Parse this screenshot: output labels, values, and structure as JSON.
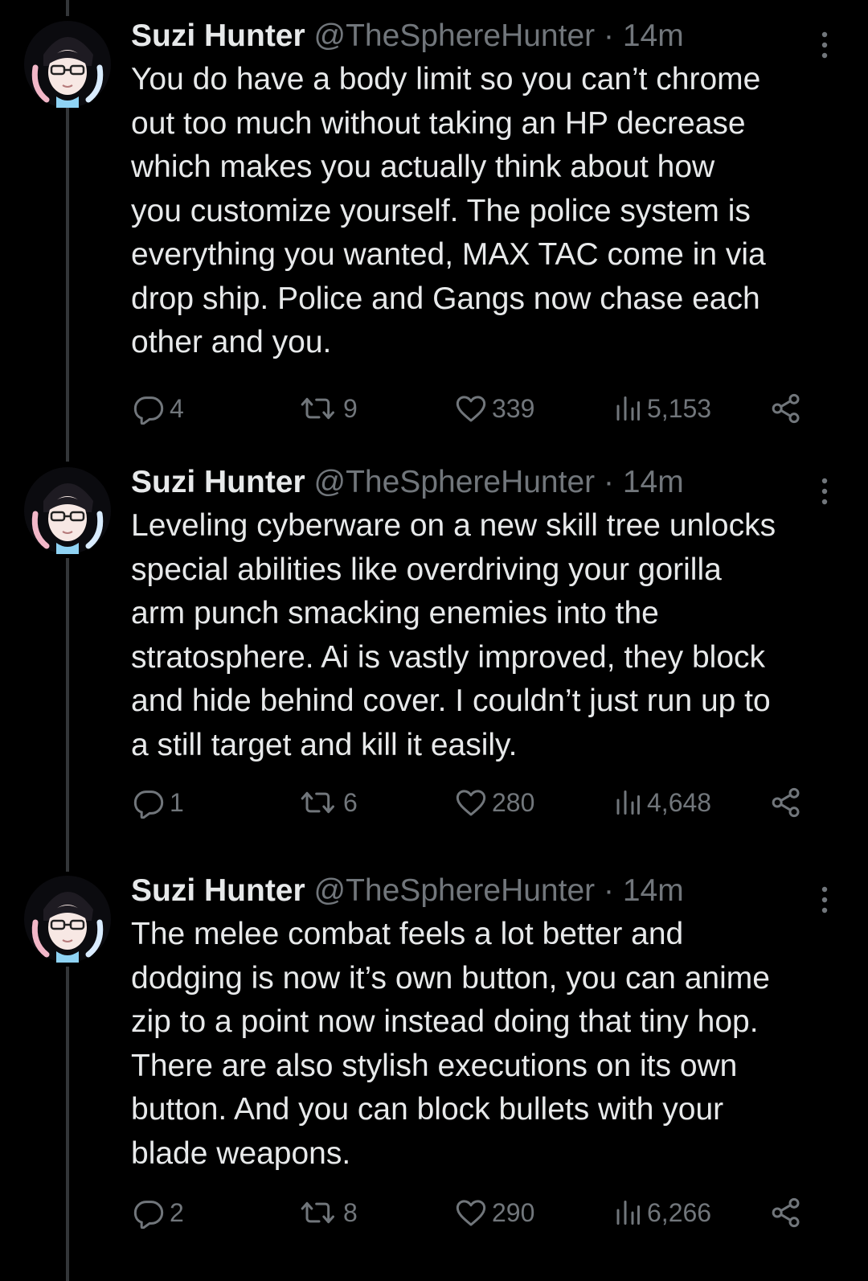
{
  "colors": {
    "background": "#000000",
    "text": "#e7e9ea",
    "secondary": "#71767b",
    "thread_line": "#333639"
  },
  "tweets": [
    {
      "name": "Suzi Hunter",
      "handle": "@TheSphereHunter",
      "separator": "·",
      "time": "14m",
      "lines": [
        "You do have a body limit so you can’t chrome",
        "out too much without taking an HP decrease",
        "which makes you actually think about how",
        "you customize yourself. The police system is",
        "everything you wanted, MAX TAC come in via",
        "drop ship. Police and Gangs now chase each",
        "other and you."
      ],
      "replies": "4",
      "retweets": "9",
      "likes": "339",
      "views": "5,153",
      "icons": [
        "reply-icon",
        "retweet-icon",
        "like-icon",
        "views-icon",
        "share-icon",
        "more-icon"
      ]
    },
    {
      "name": "Suzi Hunter",
      "handle": "@TheSphereHunter",
      "separator": "·",
      "time": "14m",
      "lines": [
        "Leveling cyberware on a new skill tree unlocks",
        "special abilities like overdriving your gorilla",
        "arm punch smacking enemies into the",
        "stratosphere. Ai is vastly improved, they block",
        "and hide behind cover. I couldn’t just run up to",
        "a still target and kill it easily."
      ],
      "replies": "1",
      "retweets": "6",
      "likes": "280",
      "views": "4,648",
      "icons": [
        "reply-icon",
        "retweet-icon",
        "like-icon",
        "views-icon",
        "share-icon",
        "more-icon"
      ]
    },
    {
      "name": "Suzi Hunter",
      "handle": "@TheSphereHunter",
      "separator": "·",
      "time": "14m",
      "lines": [
        "The melee combat feels a lot better and",
        "dodging is now it’s own button, you can anime",
        "zip to a point now instead doing that tiny hop.",
        "There are also stylish executions on its own",
        "button. And you can block bullets with your",
        "blade weapons."
      ],
      "replies": "2",
      "retweets": "8",
      "likes": "290",
      "views": "6,266",
      "icons": [
        "reply-icon",
        "retweet-icon",
        "like-icon",
        "views-icon",
        "share-icon",
        "more-icon"
      ]
    }
  ]
}
